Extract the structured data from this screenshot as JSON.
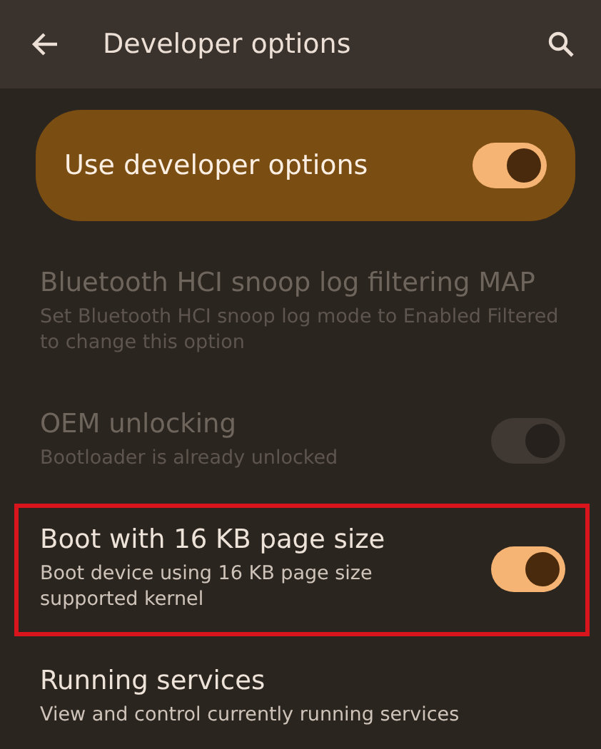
{
  "app_bar": {
    "title": "Developer options"
  },
  "main_switch": {
    "label": "Use developer options",
    "on": true
  },
  "settings": [
    {
      "kind": "text",
      "title": "Bluetooth HCI snoop log filtering MAP",
      "summary": "Set Bluetooth HCI snoop log mode to Enabled Filtered to change this option",
      "disabled": true,
      "highlighted": false
    },
    {
      "kind": "switch",
      "title": "OEM unlocking",
      "summary": "Bootloader is already unlocked",
      "disabled": true,
      "on": true,
      "highlighted": false
    },
    {
      "kind": "switch",
      "title": "Boot with 16 KB page size",
      "summary": "Boot device using 16 KB page size supported kernel",
      "disabled": false,
      "on": true,
      "highlighted": true
    },
    {
      "kind": "text",
      "title": "Running services",
      "summary": "View and control currently running services",
      "disabled": false,
      "highlighted": false
    }
  ]
}
